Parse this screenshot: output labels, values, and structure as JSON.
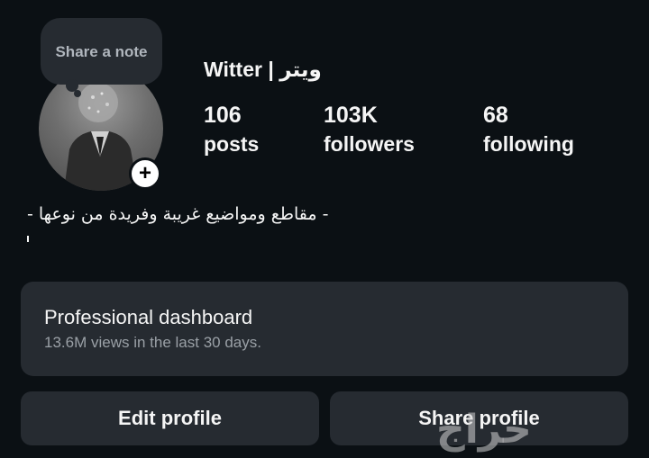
{
  "profile": {
    "note_text": "Share a note",
    "username": "Witter | ويتر",
    "stats": {
      "posts_count": "106",
      "posts_label": "posts",
      "followers_count": "103K",
      "followers_label": "followers",
      "following_count": "68",
      "following_label": "following"
    },
    "bio": "- مقاطع ومواضيع غريبة وفريدة من نوعها -",
    "add_icon": "plus-icon"
  },
  "dashboard": {
    "title": "Professional dashboard",
    "subtitle": "13.6M views in the last 30 days."
  },
  "actions": {
    "edit_label": "Edit profile",
    "share_label": "Share profile"
  },
  "watermark": {
    "text": "حراج"
  },
  "colors": {
    "background": "#0b1014",
    "card": "#262b31",
    "text": "#f5f5f5",
    "muted": "#9aa0a6"
  }
}
